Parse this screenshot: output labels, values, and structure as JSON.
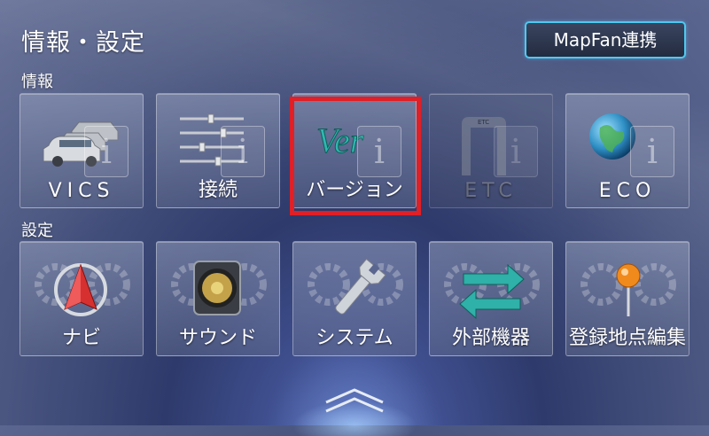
{
  "header": {
    "title": "情報・設定",
    "mapfan_button": "MapFan連携"
  },
  "sections": {
    "info_label": "情報",
    "settings_label": "設定"
  },
  "info_tiles": [
    {
      "label": "VICS",
      "icon": "cars-icon",
      "enabled": true
    },
    {
      "label": "接続",
      "icon": "sliders-icon",
      "enabled": true
    },
    {
      "label": "バージョン",
      "icon": "version-icon",
      "icon_text": "Ver",
      "enabled": true,
      "selected": true
    },
    {
      "label": "ETC",
      "icon": "etc-gate-icon",
      "icon_text": "ETC",
      "enabled": false
    },
    {
      "label": "ECO",
      "icon": "globe-icon",
      "enabled": true
    }
  ],
  "info_badge_glyph": "i",
  "settings_tiles": [
    {
      "label": "ナビ",
      "icon": "navigation-arrow-icon"
    },
    {
      "label": "サウンド",
      "icon": "speaker-icon"
    },
    {
      "label": "システム",
      "icon": "wrench-icon"
    },
    {
      "label": "外部機器",
      "icon": "connection-arrows-icon"
    },
    {
      "label": "登録地点編集",
      "icon": "map-pin-icon"
    }
  ],
  "colors": {
    "accent_border": "#4ec9f0",
    "selection_frame": "#e01f26",
    "version_text": "#2fb8b0"
  }
}
